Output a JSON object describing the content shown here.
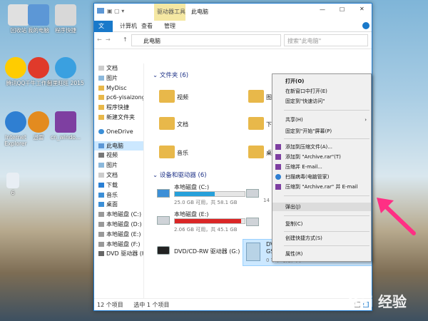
{
  "desktop_icons": [
    {
      "label": "回收站",
      "color": "#e0e0e0"
    },
    {
      "label": "我的电脑",
      "color": "#5c97d6"
    },
    {
      "label": "程序快捷",
      "color": "#d8d8d8"
    },
    {
      "label": "腾讯QQ",
      "color": "#ffcc00"
    },
    {
      "label": "千牛工作台",
      "color": "#e03a2b"
    },
    {
      "label": "阿里旺旺 2015",
      "color": "#3aa0e0"
    },
    {
      "label": "Internet Explorer",
      "color": "#2f7fd2"
    },
    {
      "label": "迅雷",
      "color": "#e38b1f"
    },
    {
      "label": "cn_windo...",
      "color": "#7e3fa1"
    },
    {
      "label": "6",
      "color": "#e8eef4"
    }
  ],
  "window": {
    "title": "此电脑",
    "drive_tools_label": "驱动器工具",
    "tabs": [
      "文件",
      "计算机",
      "查看",
      "管理"
    ],
    "address": "此电脑",
    "search_placeholder": "搜索\"此电脑\"",
    "status_left": "12 个项目",
    "status_right": "选中 1 个项目"
  },
  "nav": {
    "items": [
      "文档",
      "图片",
      "MyDisc",
      "pc6-yisaizongh",
      "程序快捷",
      "新建文件夹",
      "OneDrive",
      "此电脑",
      "视频",
      "图片",
      "文档",
      "下载",
      "音乐",
      "桌面",
      "本地磁盘 (C:)",
      "本地磁盘 (D:)",
      "本地磁盘 (E:)",
      "本地磁盘 (F:)",
      "DVD 驱动器 (H:)"
    ]
  },
  "content": {
    "folders_header": "文件夹 (6)",
    "folders": [
      "视频",
      "图片",
      "文档",
      "下载",
      "音乐",
      "桌面"
    ],
    "devices_header": "设备和驱动器 (6)",
    "drives": [
      {
        "name": "本地磁盘 (C:)",
        "size": "25.0 GB 可用，共 58.1 GB",
        "used": 0.57,
        "color": "#26a0da"
      },
      {
        "name": "本地磁盘 (E:)",
        "size": "2.06 GB 可用，共 45.1 GB",
        "used": 0.95,
        "color": "#da2626"
      },
      {
        "name": "DVD/CD-RW 驱动器 (G:)",
        "size": "",
        "used": 0,
        "color": "#26a0da"
      }
    ],
    "partial_drive_labels": [
      "14",
      "DV",
      "GS",
      "0 字节可用，共 3.16 GB"
    ]
  },
  "context_menu": {
    "items": [
      "打开(O)",
      "在新窗口中打开(E)",
      "固定到\"快速访问\"",
      "共享(H)",
      "固定到\"开始\"屏幕(P)",
      "添加到压缩文件(A)...",
      "添加到 \"Archive.rar\"(T)",
      "压缩并 E-mail...",
      "扫描病毒(电脑管家)",
      "压缩到 \"Archive.rar\" 并 E-mail",
      "弹出(J)",
      "复制(C)",
      "创建快捷方式(S)",
      "属性(R)"
    ],
    "highlighted": "弹出(J)"
  },
  "watermark": "Bai 经验"
}
